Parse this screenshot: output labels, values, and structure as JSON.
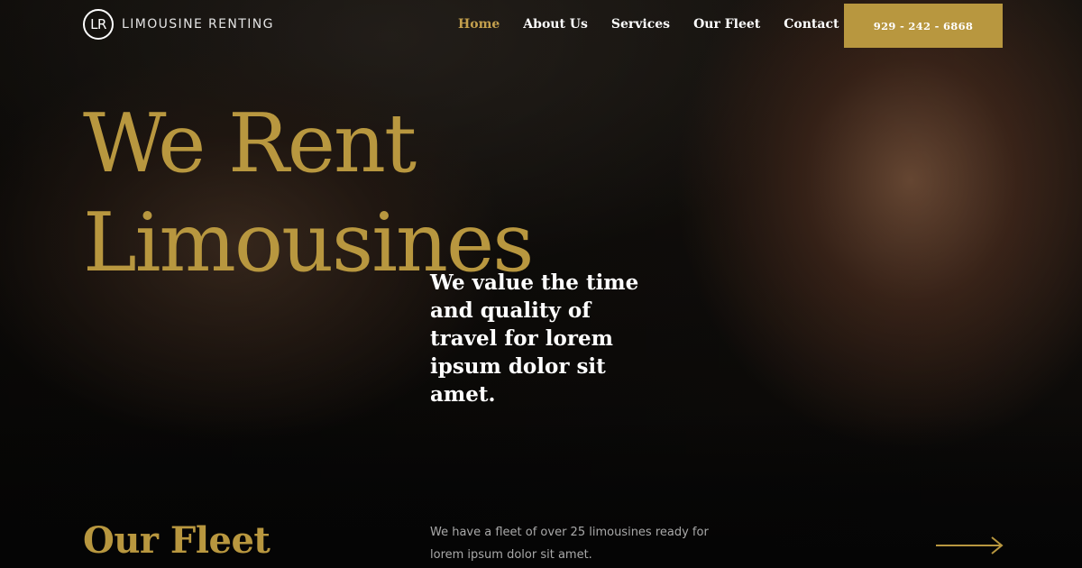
{
  "brand": {
    "monogram": "LR",
    "name": "LIMOUSINE RENTING"
  },
  "nav": {
    "items": [
      {
        "label": "Home",
        "active": true
      },
      {
        "label": "About Us",
        "active": false
      },
      {
        "label": "Services",
        "active": false
      },
      {
        "label": "Our Fleet",
        "active": false
      },
      {
        "label": "Contact",
        "active": false
      }
    ]
  },
  "cta": {
    "phone": "929 - 242 - 6868"
  },
  "hero": {
    "headline_line1": "We Rent",
    "headline_line2": "Limousines",
    "tagline": "We value the time and quality of travel for lorem ipsum dolor sit amet."
  },
  "fleet": {
    "title": "Our Fleet",
    "description": "We have a fleet of over 25 limousines ready for lorem ipsum dolor sit amet.",
    "arrow_icon": "arrow-right-icon"
  },
  "colors": {
    "accent": "#b8973f",
    "background": "#0a0a0a",
    "text_light": "#ffffff",
    "text_muted": "#a9a9a9"
  }
}
